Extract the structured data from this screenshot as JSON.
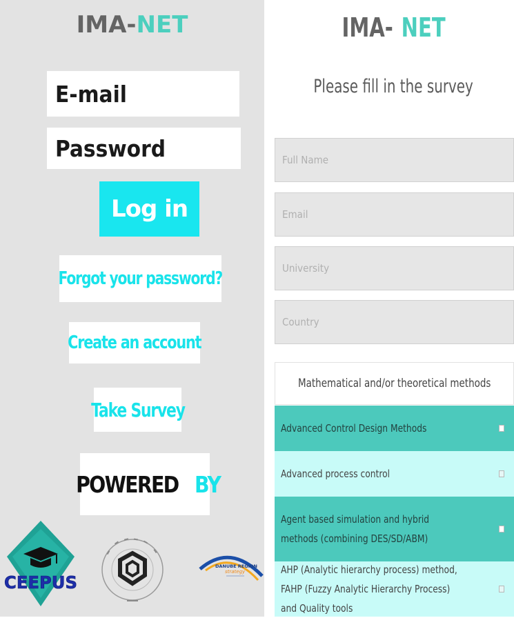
{
  "left_panel": {
    "brand": {
      "part1": "IMA-",
      "part2": "NET"
    },
    "email_placeholder": "E-mail",
    "password_placeholder": "Password",
    "login_label": "Log in",
    "forgot_label": "Forgot your password?",
    "create_label": "Create an account",
    "survey_label": "Take Survey",
    "powered": {
      "text": "POWERED",
      "by": "BY"
    },
    "logos": {
      "ceepus": "CEEPUS",
      "danube_line1": "DANUBE REGION",
      "danube_line2": "strategy"
    }
  },
  "right_panel": {
    "brand": {
      "part1": "IMA-",
      "part2": "NET"
    },
    "heading": "Please fill in the survey",
    "fields": [
      {
        "placeholder": "Full Name"
      },
      {
        "placeholder": "Email"
      },
      {
        "placeholder": "University"
      },
      {
        "placeholder": "Country"
      }
    ],
    "section_title": "Mathematical and/or theoretical methods",
    "options": [
      {
        "label": "Advanced Control Design Methods",
        "checked": false
      },
      {
        "label": "Advanced process control",
        "checked": false
      },
      {
        "label": "Agent based simulation and hybrid methods (combining DES/SD/ABM)",
        "checked": false
      },
      {
        "label": "AHP (Analytic hierarchy process) method, FAHP (Fuzzy Analytic Hierarchy Process) and Quality tools",
        "checked": false
      }
    ]
  },
  "colors": {
    "teal": "#4ccfbe",
    "cyan": "#19e6ef",
    "option_dark": "#4cc9bc",
    "option_light": "#c8fbf8"
  }
}
